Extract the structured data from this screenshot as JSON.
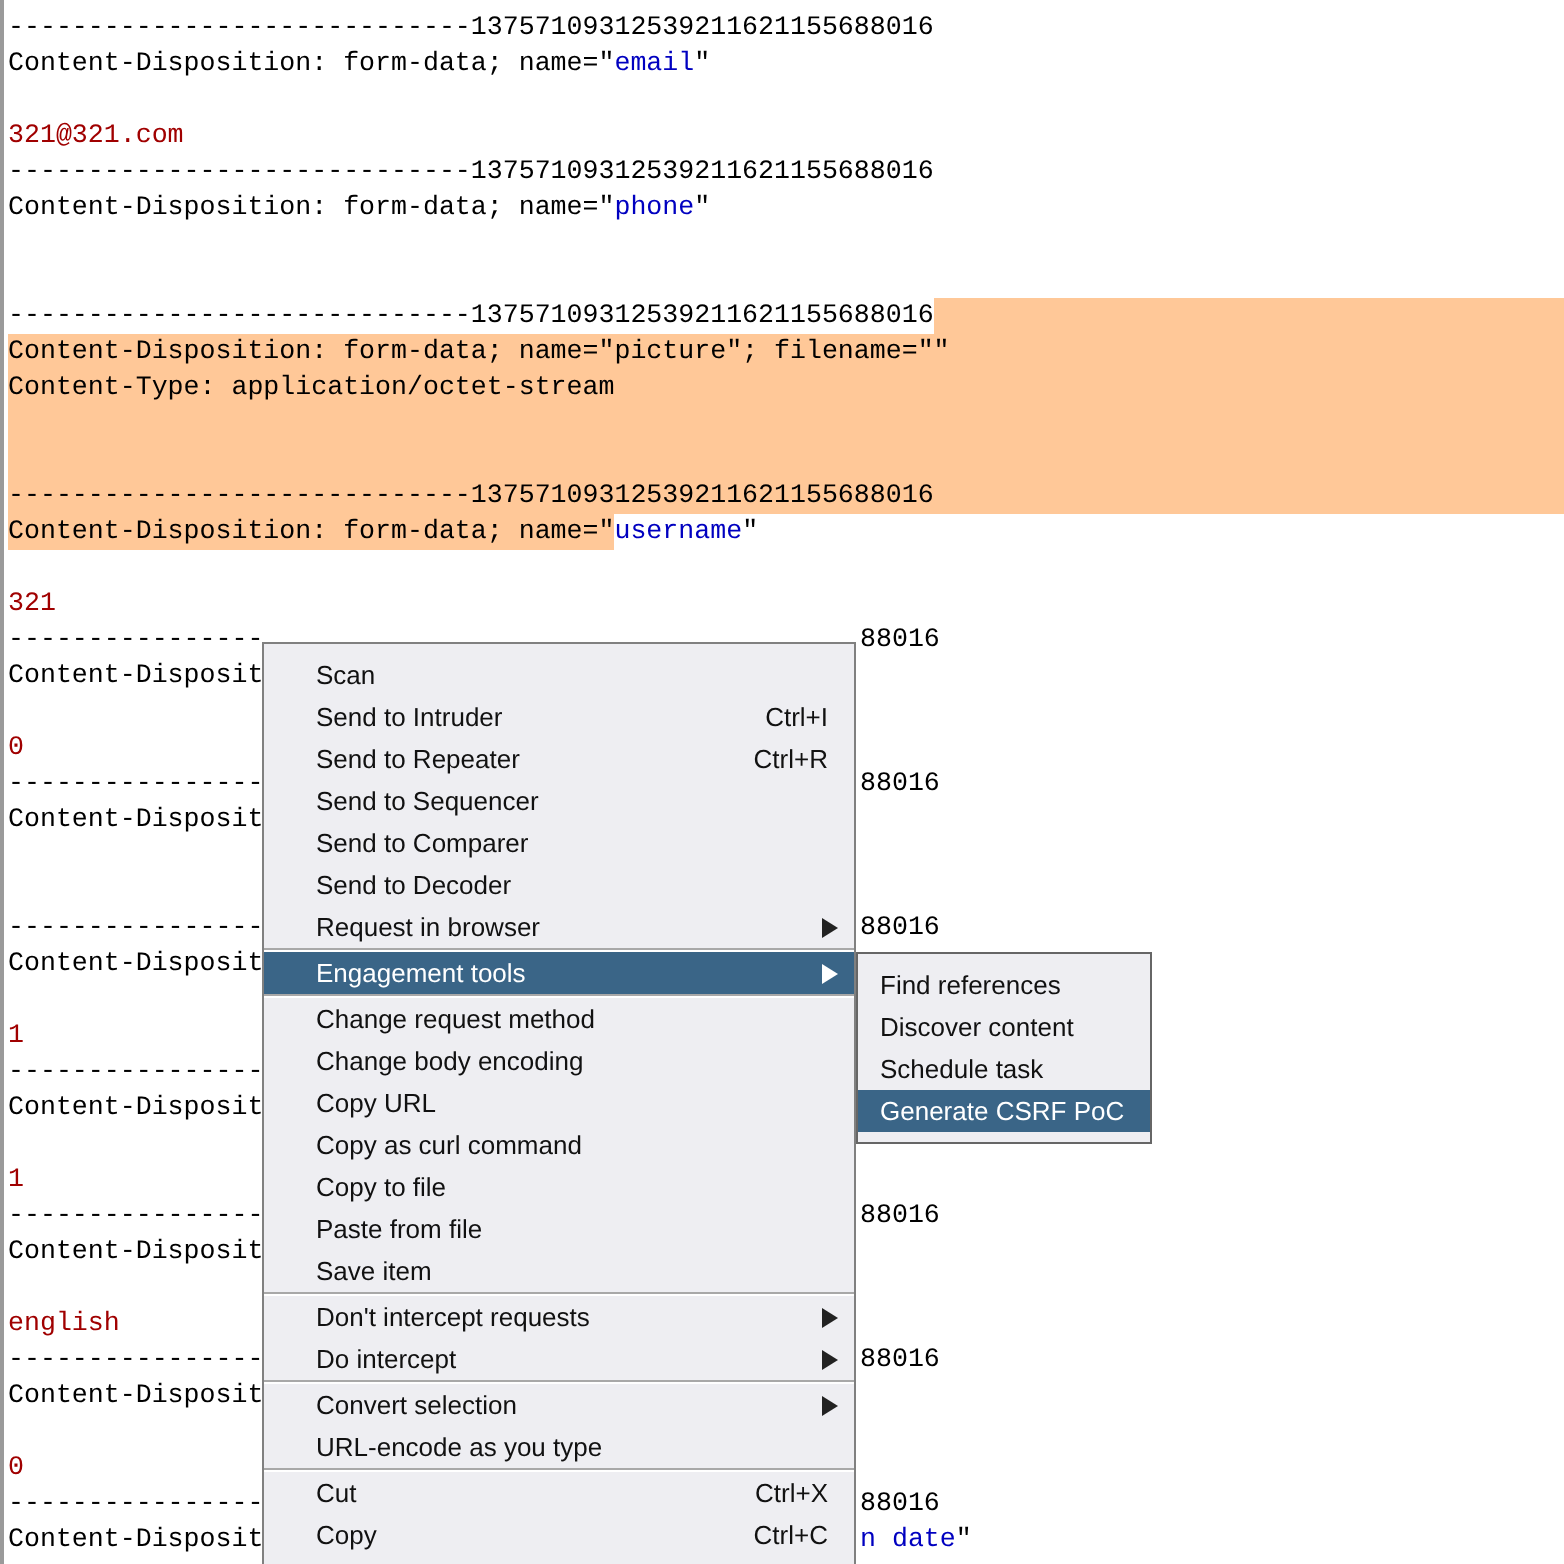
{
  "editor": {
    "lines": [
      {
        "segments": [
          {
            "text": "-----------------------------13757109312539211621155688016",
            "kind": "plain",
            "selected": false
          }
        ],
        "eol_selected": false
      },
      {
        "segments": [
          {
            "text": "Content-Disposition: form-data; name=\"",
            "kind": "plain",
            "selected": false
          },
          {
            "text": "email",
            "kind": "name",
            "selected": false
          },
          {
            "text": "\"",
            "kind": "plain",
            "selected": false
          }
        ],
        "eol_selected": false
      },
      {
        "eol_selected": false
      },
      {
        "segments": [
          {
            "text": "321@321.com",
            "kind": "value",
            "selected": false
          }
        ],
        "eol_selected": false
      },
      {
        "segments": [
          {
            "text": "-----------------------------13757109312539211621155688016",
            "kind": "plain",
            "selected": false
          }
        ],
        "eol_selected": false
      },
      {
        "segments": [
          {
            "text": "Content-Disposition: form-data; name=\"",
            "kind": "plain",
            "selected": false
          },
          {
            "text": "phone",
            "kind": "name",
            "selected": false
          },
          {
            "text": "\"",
            "kind": "plain",
            "selected": false
          }
        ],
        "eol_selected": false
      },
      {
        "eol_selected": false
      },
      {
        "eol_selected": false
      },
      {
        "segments": [
          {
            "text": "-----------------------------13757109312539211621155688016",
            "kind": "plain",
            "selected": false
          }
        ],
        "eol_selected": true
      },
      {
        "segments": [
          {
            "text": "Content-Disposition: form-data; name=\"picture\"; filename=\"\"",
            "kind": "plain",
            "selected": true
          }
        ],
        "eol_selected": true
      },
      {
        "segments": [
          {
            "text": "Content-Type: application/octet-stream",
            "kind": "plain",
            "selected": true
          }
        ],
        "eol_selected": true
      },
      {
        "eol_selected": true
      },
      {
        "eol_selected": true
      },
      {
        "segments": [
          {
            "text": "-----------------------------13757109312539211621155688016",
            "kind": "plain",
            "selected": true
          }
        ],
        "eol_selected": true
      },
      {
        "segments": [
          {
            "text": "Content-Disposition: form-data; name=\"",
            "kind": "plain",
            "selected": true
          },
          {
            "text": "username",
            "kind": "name",
            "selected": false
          },
          {
            "text": "\"",
            "kind": "plain",
            "selected": false
          }
        ],
        "eol_selected": false
      },
      {
        "eol_selected": false
      },
      {
        "segments": [
          {
            "text": "321",
            "kind": "value",
            "selected": false
          }
        ],
        "eol_selected": false
      },
      {
        "segments": [
          {
            "text": "----------------",
            "kind": "plain",
            "selected": false
          }
        ],
        "tail": [
          {
            "text": "88016",
            "kind": "plain"
          }
        ],
        "eol_selected": false
      },
      {
        "segments": [
          {
            "text": "Content-Disposit",
            "kind": "plain",
            "selected": false
          }
        ],
        "eol_selected": false
      },
      {
        "eol_selected": false
      },
      {
        "segments": [
          {
            "text": "0",
            "kind": "value",
            "selected": false
          }
        ],
        "eol_selected": false
      },
      {
        "segments": [
          {
            "text": "----------------",
            "kind": "plain",
            "selected": false
          }
        ],
        "tail": [
          {
            "text": "88016",
            "kind": "plain"
          }
        ],
        "eol_selected": false
      },
      {
        "segments": [
          {
            "text": "Content-Disposit",
            "kind": "plain",
            "selected": false
          }
        ],
        "eol_selected": false
      },
      {
        "eol_selected": false
      },
      {
        "eol_selected": false
      },
      {
        "segments": [
          {
            "text": "----------------",
            "kind": "plain",
            "selected": false
          }
        ],
        "tail": [
          {
            "text": "88016",
            "kind": "plain"
          }
        ],
        "eol_selected": false
      },
      {
        "segments": [
          {
            "text": "Content-Disposit",
            "kind": "plain",
            "selected": false
          }
        ],
        "eol_selected": false
      },
      {
        "eol_selected": false
      },
      {
        "segments": [
          {
            "text": "1",
            "kind": "value",
            "selected": false
          }
        ],
        "eol_selected": false
      },
      {
        "segments": [
          {
            "text": "----------------",
            "kind": "plain",
            "selected": false
          }
        ],
        "eol_selected": false
      },
      {
        "segments": [
          {
            "text": "Content-Disposit",
            "kind": "plain",
            "selected": false
          }
        ],
        "eol_selected": false
      },
      {
        "eol_selected": false
      },
      {
        "segments": [
          {
            "text": "1",
            "kind": "value",
            "selected": false
          }
        ],
        "eol_selected": false
      },
      {
        "segments": [
          {
            "text": "----------------",
            "kind": "plain",
            "selected": false
          }
        ],
        "tail": [
          {
            "text": "88016",
            "kind": "plain"
          }
        ],
        "eol_selected": false
      },
      {
        "segments": [
          {
            "text": "Content-Disposit",
            "kind": "plain",
            "selected": false
          }
        ],
        "eol_selected": false
      },
      {
        "eol_selected": false
      },
      {
        "segments": [
          {
            "text": "english",
            "kind": "value",
            "selected": false
          }
        ],
        "eol_selected": false
      },
      {
        "segments": [
          {
            "text": "----------------",
            "kind": "plain",
            "selected": false
          }
        ],
        "tail": [
          {
            "text": "88016",
            "kind": "plain"
          }
        ],
        "eol_selected": false
      },
      {
        "segments": [
          {
            "text": "Content-Disposit",
            "kind": "plain",
            "selected": false
          }
        ],
        "eol_selected": false
      },
      {
        "eol_selected": false
      },
      {
        "segments": [
          {
            "text": "0",
            "kind": "value",
            "selected": false
          }
        ],
        "eol_selected": false
      },
      {
        "segments": [
          {
            "text": "----------------",
            "kind": "plain",
            "selected": false
          }
        ],
        "tail": [
          {
            "text": "88016",
            "kind": "plain"
          }
        ],
        "eol_selected": false
      },
      {
        "segments": [
          {
            "text": "Content-Disposit",
            "kind": "plain",
            "selected": false
          }
        ],
        "tail": [
          {
            "text": "n date",
            "kind": "name"
          },
          {
            "text": "\"",
            "kind": "plain"
          }
        ],
        "eol_selected": false
      }
    ]
  },
  "context_menu": {
    "groups": [
      [
        {
          "label": "Scan",
          "submenu": false,
          "selected": false
        },
        {
          "label": "Send to Intruder",
          "shortcut": "Ctrl+I",
          "submenu": false,
          "selected": false
        },
        {
          "label": "Send to Repeater",
          "shortcut": "Ctrl+R",
          "submenu": false,
          "selected": false
        },
        {
          "label": "Send to Sequencer",
          "submenu": false,
          "selected": false
        },
        {
          "label": "Send to Comparer",
          "submenu": false,
          "selected": false
        },
        {
          "label": "Send to Decoder",
          "submenu": false,
          "selected": false
        },
        {
          "label": "Request in browser",
          "submenu": true,
          "selected": false
        }
      ],
      [
        {
          "label": "Engagement tools",
          "submenu": true,
          "selected": true
        }
      ],
      [
        {
          "label": "Change request method",
          "submenu": false,
          "selected": false
        },
        {
          "label": "Change body encoding",
          "submenu": false,
          "selected": false
        },
        {
          "label": "Copy URL",
          "submenu": false,
          "selected": false
        },
        {
          "label": "Copy as curl command",
          "submenu": false,
          "selected": false
        },
        {
          "label": "Copy to file",
          "submenu": false,
          "selected": false
        },
        {
          "label": "Paste from file",
          "submenu": false,
          "selected": false
        },
        {
          "label": "Save item",
          "submenu": false,
          "selected": false
        }
      ],
      [
        {
          "label": "Don't intercept requests",
          "submenu": true,
          "selected": false
        },
        {
          "label": "Do intercept",
          "submenu": true,
          "selected": false
        }
      ],
      [
        {
          "label": "Convert selection",
          "submenu": true,
          "selected": false
        },
        {
          "label": "URL-encode as you type",
          "submenu": false,
          "selected": false
        }
      ],
      [
        {
          "label": "Cut",
          "shortcut": "Ctrl+X",
          "submenu": false,
          "selected": false
        },
        {
          "label": "Copy",
          "shortcut": "Ctrl+C",
          "submenu": false,
          "selected": false
        }
      ]
    ]
  },
  "submenu": {
    "items": [
      {
        "label": "Find references",
        "selected": false
      },
      {
        "label": "Discover content",
        "selected": false
      },
      {
        "label": "Schedule task",
        "selected": false
      },
      {
        "label": "Generate CSRF PoC",
        "selected": true
      }
    ]
  }
}
